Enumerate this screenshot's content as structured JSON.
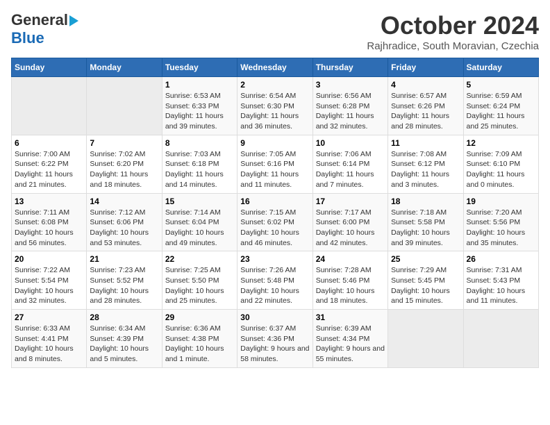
{
  "header": {
    "logo_general": "General",
    "logo_blue": "Blue",
    "month_title": "October 2024",
    "location": "Rajhradice, South Moravian, Czechia"
  },
  "calendar": {
    "columns": [
      "Sunday",
      "Monday",
      "Tuesday",
      "Wednesday",
      "Thursday",
      "Friday",
      "Saturday"
    ],
    "weeks": [
      [
        {
          "day": "",
          "sunrise": "",
          "sunset": "",
          "daylight": ""
        },
        {
          "day": "",
          "sunrise": "",
          "sunset": "",
          "daylight": ""
        },
        {
          "day": "1",
          "sunrise": "Sunrise: 6:53 AM",
          "sunset": "Sunset: 6:33 PM",
          "daylight": "Daylight: 11 hours and 39 minutes."
        },
        {
          "day": "2",
          "sunrise": "Sunrise: 6:54 AM",
          "sunset": "Sunset: 6:30 PM",
          "daylight": "Daylight: 11 hours and 36 minutes."
        },
        {
          "day": "3",
          "sunrise": "Sunrise: 6:56 AM",
          "sunset": "Sunset: 6:28 PM",
          "daylight": "Daylight: 11 hours and 32 minutes."
        },
        {
          "day": "4",
          "sunrise": "Sunrise: 6:57 AM",
          "sunset": "Sunset: 6:26 PM",
          "daylight": "Daylight: 11 hours and 28 minutes."
        },
        {
          "day": "5",
          "sunrise": "Sunrise: 6:59 AM",
          "sunset": "Sunset: 6:24 PM",
          "daylight": "Daylight: 11 hours and 25 minutes."
        }
      ],
      [
        {
          "day": "6",
          "sunrise": "Sunrise: 7:00 AM",
          "sunset": "Sunset: 6:22 PM",
          "daylight": "Daylight: 11 hours and 21 minutes."
        },
        {
          "day": "7",
          "sunrise": "Sunrise: 7:02 AM",
          "sunset": "Sunset: 6:20 PM",
          "daylight": "Daylight: 11 hours and 18 minutes."
        },
        {
          "day": "8",
          "sunrise": "Sunrise: 7:03 AM",
          "sunset": "Sunset: 6:18 PM",
          "daylight": "Daylight: 11 hours and 14 minutes."
        },
        {
          "day": "9",
          "sunrise": "Sunrise: 7:05 AM",
          "sunset": "Sunset: 6:16 PM",
          "daylight": "Daylight: 11 hours and 11 minutes."
        },
        {
          "day": "10",
          "sunrise": "Sunrise: 7:06 AM",
          "sunset": "Sunset: 6:14 PM",
          "daylight": "Daylight: 11 hours and 7 minutes."
        },
        {
          "day": "11",
          "sunrise": "Sunrise: 7:08 AM",
          "sunset": "Sunset: 6:12 PM",
          "daylight": "Daylight: 11 hours and 3 minutes."
        },
        {
          "day": "12",
          "sunrise": "Sunrise: 7:09 AM",
          "sunset": "Sunset: 6:10 PM",
          "daylight": "Daylight: 11 hours and 0 minutes."
        }
      ],
      [
        {
          "day": "13",
          "sunrise": "Sunrise: 7:11 AM",
          "sunset": "Sunset: 6:08 PM",
          "daylight": "Daylight: 10 hours and 56 minutes."
        },
        {
          "day": "14",
          "sunrise": "Sunrise: 7:12 AM",
          "sunset": "Sunset: 6:06 PM",
          "daylight": "Daylight: 10 hours and 53 minutes."
        },
        {
          "day": "15",
          "sunrise": "Sunrise: 7:14 AM",
          "sunset": "Sunset: 6:04 PM",
          "daylight": "Daylight: 10 hours and 49 minutes."
        },
        {
          "day": "16",
          "sunrise": "Sunrise: 7:15 AM",
          "sunset": "Sunset: 6:02 PM",
          "daylight": "Daylight: 10 hours and 46 minutes."
        },
        {
          "day": "17",
          "sunrise": "Sunrise: 7:17 AM",
          "sunset": "Sunset: 6:00 PM",
          "daylight": "Daylight: 10 hours and 42 minutes."
        },
        {
          "day": "18",
          "sunrise": "Sunrise: 7:18 AM",
          "sunset": "Sunset: 5:58 PM",
          "daylight": "Daylight: 10 hours and 39 minutes."
        },
        {
          "day": "19",
          "sunrise": "Sunrise: 7:20 AM",
          "sunset": "Sunset: 5:56 PM",
          "daylight": "Daylight: 10 hours and 35 minutes."
        }
      ],
      [
        {
          "day": "20",
          "sunrise": "Sunrise: 7:22 AM",
          "sunset": "Sunset: 5:54 PM",
          "daylight": "Daylight: 10 hours and 32 minutes."
        },
        {
          "day": "21",
          "sunrise": "Sunrise: 7:23 AM",
          "sunset": "Sunset: 5:52 PM",
          "daylight": "Daylight: 10 hours and 28 minutes."
        },
        {
          "day": "22",
          "sunrise": "Sunrise: 7:25 AM",
          "sunset": "Sunset: 5:50 PM",
          "daylight": "Daylight: 10 hours and 25 minutes."
        },
        {
          "day": "23",
          "sunrise": "Sunrise: 7:26 AM",
          "sunset": "Sunset: 5:48 PM",
          "daylight": "Daylight: 10 hours and 22 minutes."
        },
        {
          "day": "24",
          "sunrise": "Sunrise: 7:28 AM",
          "sunset": "Sunset: 5:46 PM",
          "daylight": "Daylight: 10 hours and 18 minutes."
        },
        {
          "day": "25",
          "sunrise": "Sunrise: 7:29 AM",
          "sunset": "Sunset: 5:45 PM",
          "daylight": "Daylight: 10 hours and 15 minutes."
        },
        {
          "day": "26",
          "sunrise": "Sunrise: 7:31 AM",
          "sunset": "Sunset: 5:43 PM",
          "daylight": "Daylight: 10 hours and 11 minutes."
        }
      ],
      [
        {
          "day": "27",
          "sunrise": "Sunrise: 6:33 AM",
          "sunset": "Sunset: 4:41 PM",
          "daylight": "Daylight: 10 hours and 8 minutes."
        },
        {
          "day": "28",
          "sunrise": "Sunrise: 6:34 AM",
          "sunset": "Sunset: 4:39 PM",
          "daylight": "Daylight: 10 hours and 5 minutes."
        },
        {
          "day": "29",
          "sunrise": "Sunrise: 6:36 AM",
          "sunset": "Sunset: 4:38 PM",
          "daylight": "Daylight: 10 hours and 1 minute."
        },
        {
          "day": "30",
          "sunrise": "Sunrise: 6:37 AM",
          "sunset": "Sunset: 4:36 PM",
          "daylight": "Daylight: 9 hours and 58 minutes."
        },
        {
          "day": "31",
          "sunrise": "Sunrise: 6:39 AM",
          "sunset": "Sunset: 4:34 PM",
          "daylight": "Daylight: 9 hours and 55 minutes."
        },
        {
          "day": "",
          "sunrise": "",
          "sunset": "",
          "daylight": ""
        },
        {
          "day": "",
          "sunrise": "",
          "sunset": "",
          "daylight": ""
        }
      ]
    ]
  }
}
